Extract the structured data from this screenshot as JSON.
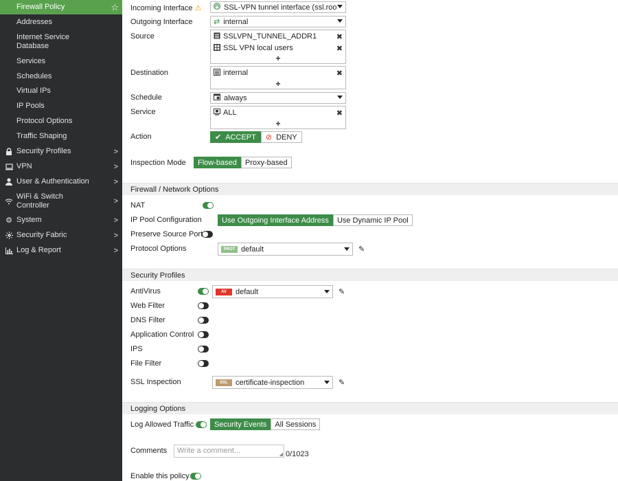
{
  "sidebar": {
    "items": [
      {
        "label": "Firewall Policy",
        "icon": "",
        "chev": false
      },
      {
        "label": "Addresses"
      },
      {
        "label": "Internet Service Database"
      },
      {
        "label": "Services"
      },
      {
        "label": "Schedules"
      },
      {
        "label": "Virtual IPs"
      },
      {
        "label": "IP Pools"
      },
      {
        "label": "Protocol Options"
      },
      {
        "label": "Traffic Shaping"
      },
      {
        "label": "Security Profiles",
        "icon": "lock-icon"
      },
      {
        "label": "VPN",
        "icon": "monitor-icon"
      },
      {
        "label": "User & Authentication",
        "icon": "user-icon"
      },
      {
        "label": "WiFi & Switch Controller",
        "icon": "wifi-icon"
      },
      {
        "label": "System",
        "icon": "gear-icon"
      },
      {
        "label": "Security Fabric",
        "icon": "fabric-icon"
      },
      {
        "label": "Log & Report",
        "icon": "chart-icon"
      }
    ],
    "favorite_icon": "star-icon",
    "accent": "#5aa14e",
    "background": "#2b2d2f"
  },
  "form": {
    "incoming": {
      "label": "Incoming Interface",
      "value": "SSL-VPN tunnel interface (ssl.roo",
      "warning_icon": "warning-icon"
    },
    "outgoing": {
      "label": "Outgoing Interface",
      "value": "internal"
    },
    "source": {
      "label": "Source",
      "items": [
        "SSLVPN_TUNNEL_ADDR1",
        "SSL VPN local users"
      ]
    },
    "destination": {
      "label": "Destination",
      "items": [
        "internal"
      ]
    },
    "schedule": {
      "label": "Schedule",
      "value": "always"
    },
    "service": {
      "label": "Service",
      "items": [
        "ALL"
      ]
    },
    "action": {
      "label": "Action",
      "accept": "ACCEPT",
      "deny": "DENY",
      "selected": "ACCEPT"
    },
    "inspection_mode": {
      "label": "Inspection Mode",
      "options": [
        "Flow-based",
        "Proxy-based"
      ],
      "selected": "Flow-based"
    },
    "add_symbol": "+",
    "remove_symbol": "✖"
  },
  "network_options": {
    "header": "Firewall / Network Options",
    "nat": {
      "label": "NAT",
      "enabled": true
    },
    "ip_pool": {
      "label": "IP Pool Configuration",
      "options": [
        "Use Outgoing Interface Address",
        "Use Dynamic IP Pool"
      ],
      "selected": "Use Outgoing Interface Address"
    },
    "preserve_port": {
      "label": "Preserve Source Port",
      "enabled": false
    },
    "protocol_options": {
      "label": "Protocol Options",
      "tag": "PROT",
      "value": "default"
    }
  },
  "security_profiles": {
    "header": "Security Profiles",
    "antivirus": {
      "label": "AntiVirus",
      "enabled": true,
      "tag": "AV",
      "value": "default"
    },
    "web_filter": {
      "label": "Web Filter",
      "enabled": false
    },
    "dns_filter": {
      "label": "DNS Filter",
      "enabled": false
    },
    "app_control": {
      "label": "Application Control",
      "enabled": false
    },
    "ips": {
      "label": "IPS",
      "enabled": false
    },
    "file_filter": {
      "label": "File Filter",
      "enabled": false
    },
    "ssl_inspection": {
      "label": "SSL Inspection",
      "tag": "SSL",
      "value": "certificate-inspection"
    }
  },
  "logging": {
    "header": "Logging Options",
    "log_allowed": {
      "label": "Log Allowed Traffic",
      "enabled": true,
      "options": [
        "Security Events",
        "All Sessions"
      ],
      "selected": "Security Events"
    }
  },
  "comments": {
    "label": "Comments",
    "placeholder": "Write a comment...",
    "counter": "0/1023"
  },
  "enable_policy": {
    "label": "Enable this policy",
    "enabled": true
  },
  "colors": {
    "green_button": "#3d8c48",
    "deny_icon": "#d9342b",
    "av_tag": "#e0362c",
    "prot_tag": "#8fbf88",
    "ssl_tag": "#c09a6b",
    "warning": "#f0a020"
  }
}
